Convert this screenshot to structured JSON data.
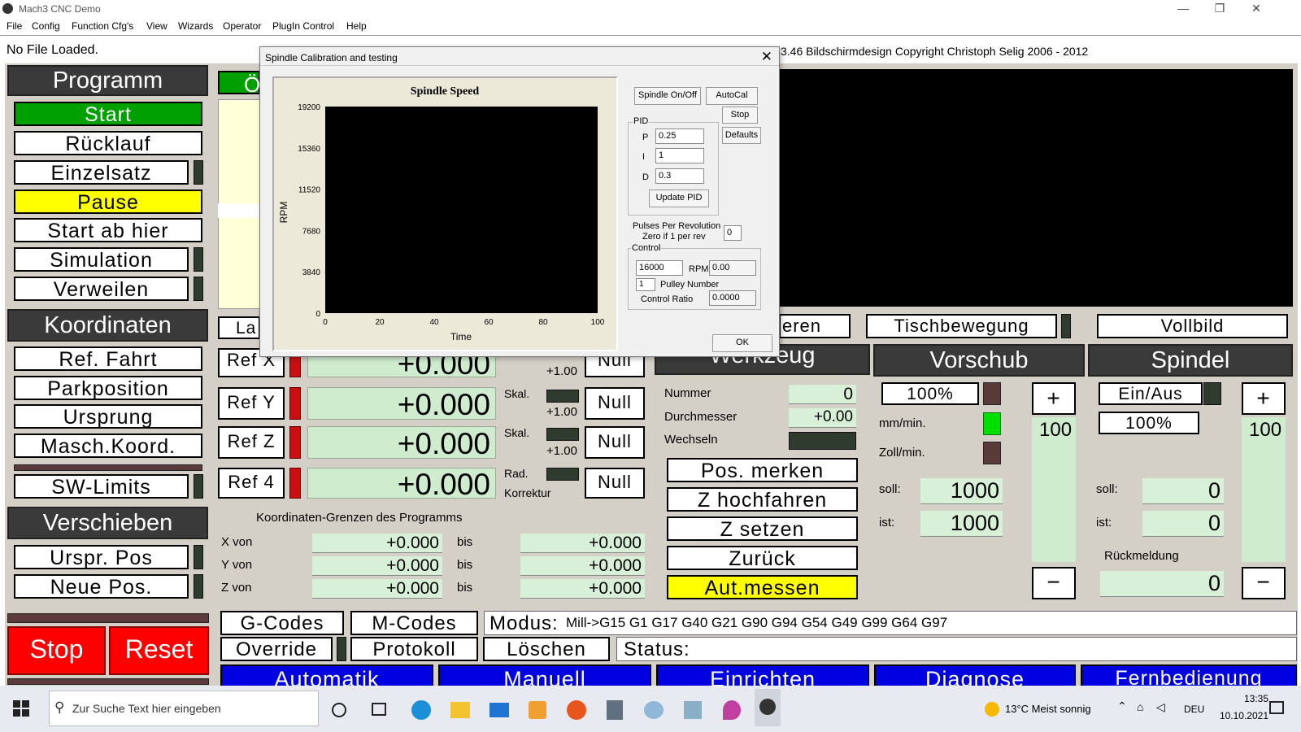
{
  "window": {
    "title": "Mach3 CNC  Demo",
    "min": "—",
    "max": "❐",
    "close": "✕"
  },
  "menu": [
    "File",
    "Config",
    "Function Cfg's",
    "View",
    "Wizards",
    "Operator",
    "PlugIn Control",
    "Help"
  ],
  "file_status": "No File Loaded.",
  "copyright": "3.46 Bildschirmdesign Copyright Christoph Selig 2006 - 2012",
  "programm": {
    "header": "Programm",
    "buttons": [
      "Start",
      "Rücklauf",
      "Einzelsatz",
      "Pause",
      "Start ab hier",
      "Simulation",
      "Verweilen"
    ]
  },
  "koordinaten": {
    "header": "Koordinaten",
    "buttons": [
      "Ref. Fahrt",
      "Parkposition",
      "Ursprung",
      "Masch.Koord.",
      "SW-Limits"
    ]
  },
  "verschieben": {
    "header": "Verschieben",
    "buttons": [
      "Urspr. Pos",
      "Neue Pos."
    ]
  },
  "top_green_partial": "Ö",
  "lau_partial": "La",
  "axes": [
    {
      "ref": "Ref X",
      "value": "+0.000",
      "skal_label": "",
      "skal_value": "+1.00",
      "null": "Null"
    },
    {
      "ref": "Ref Y",
      "value": "+0.000",
      "skal_label": "Skal.",
      "skal_value": "+1.00",
      "null": "Null"
    },
    {
      "ref": "Ref Z",
      "value": "+0.000",
      "skal_label": "Skal.",
      "skal_value": "+1.00",
      "null": "Null"
    },
    {
      "ref": "Ref 4",
      "value": "+0.000",
      "skal_label": "Rad.",
      "skal_value": "Korrektur",
      "null": "Null"
    }
  ],
  "limits": {
    "title": "Koordinaten-Grenzen des Programms",
    "rows": [
      {
        "label": "X von",
        "from": "+0.000",
        "bis": "bis",
        "to": "+0.000"
      },
      {
        "label": "Y von",
        "from": "+0.000",
        "bis": "bis",
        "to": "+0.000"
      },
      {
        "label": "Z von",
        "from": "+0.000",
        "bis": "bis",
        "to": "+0.000"
      }
    ]
  },
  "mid_buttons": {
    "eren_partial": "eren",
    "tisch": "Tischbewegung",
    "vollbild": "Vollbild"
  },
  "werkzeug": {
    "header_partial": "Werkzeug",
    "nummer_label": "Nummer",
    "nummer": "0",
    "durchmesser_label": "Durchmesser",
    "durchmesser": "+0.00",
    "wechseln_label": "Wechseln",
    "buttons": [
      "Pos. merken",
      "Z hochfahren",
      "Z setzen",
      "Zurück",
      "Aut.messen"
    ]
  },
  "vorschub": {
    "header": "Vorschub",
    "percent": "100%",
    "mm_label": "mm/min.",
    "zoll_label": "Zoll/min.",
    "soll_label": "soll:",
    "soll": "1000",
    "ist_label": "ist:",
    "ist": "1000",
    "plus": "+",
    "minus": "−",
    "slider_value": "100"
  },
  "spindel": {
    "header": "Spindel",
    "einaus": "Ein/Aus",
    "percent": "100%",
    "soll_label": "soll:",
    "soll": "0",
    "ist_label": "ist:",
    "ist": "0",
    "rueck_label": "Rückmeldung",
    "rueck": "0",
    "plus": "+",
    "minus": "−",
    "slider_value": "100"
  },
  "bottom": {
    "stop": "Stop",
    "reset": "Reset",
    "gcodes": "G-Codes",
    "mcodes": "M-Codes",
    "override": "Override",
    "protokoll": "Protokoll",
    "loeschen": "Löschen",
    "modus_label": "Modus:",
    "modus_value": "Mill->G15  G1 G17 G40 G21 G90 G94 G54 G49 G99 G64 G97",
    "status_label": "Status:",
    "nav": [
      "Automatik",
      "Manuell",
      "Einrichten",
      "Diagnose",
      "Fernbedienung"
    ]
  },
  "dialog": {
    "title": "Spindle Calibration and testing",
    "close": "✕",
    "buttons": {
      "spindle": "Spindle On/Off",
      "autocal": "AutoCal",
      "stop": "Stop",
      "defaults": "Defaults",
      "update": "Update PID",
      "ok": "OK"
    },
    "pid_label": "PID",
    "p_label": "P",
    "p": "0.25",
    "i_label": "I",
    "i": "1",
    "d_label": "D",
    "d": "0.3",
    "ppr_label1": "Pulses Per Revolution",
    "ppr_label2": "Zero if 1 per rev",
    "ppr": "0",
    "control_label": "Control",
    "control_rpm_input": "16000",
    "rpm_label": "RPM",
    "rpm_value": "0.00",
    "pulley": "1",
    "pulley_label": "Pulley Number",
    "ratio_label": "Control Ratio",
    "ratio": "0.0000"
  },
  "chart_data": {
    "type": "line",
    "title": "Spindle Speed",
    "xlabel": "Time",
    "ylabel": "RPM",
    "xlim": [
      0,
      100
    ],
    "ylim": [
      0,
      19200
    ],
    "xticks": [
      0,
      20,
      40,
      60,
      80,
      100
    ],
    "yticks": [
      0,
      3840,
      7680,
      11520,
      15360,
      19200
    ],
    "series": []
  },
  "taskbar": {
    "search_placeholder": "Zur Suche Text hier eingeben",
    "weather": "13°C  Meist sonnig",
    "lang": "DEU",
    "time": "13:35",
    "date": "10.10.2021"
  }
}
